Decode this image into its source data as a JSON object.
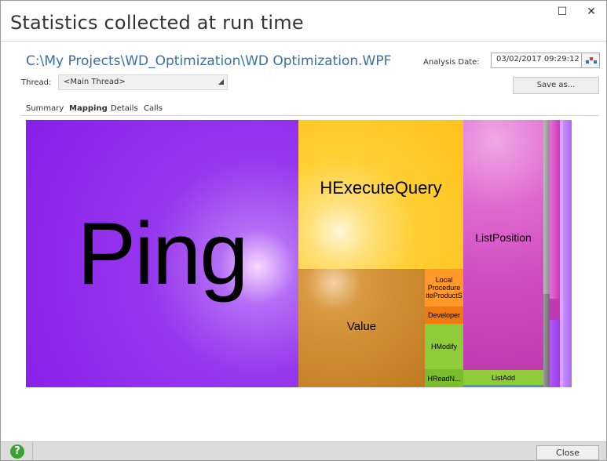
{
  "window": {
    "title": "Statistics collected at run time",
    "maximize_glyph": "☐",
    "close_glyph": "✕"
  },
  "header": {
    "file_path": "C:\\My Projects\\WD_Optimization\\WD Optimization.WPF",
    "analysis_date_label": "Analysis Date:",
    "analysis_date_value": "03/02/2017 09:29:12",
    "thread_label": "Thread:",
    "thread_value": "<Main Thread>",
    "save_as_label": "Save as..."
  },
  "tabs": [
    {
      "label": "Summary",
      "active": false
    },
    {
      "label": "Mapping",
      "active": true
    },
    {
      "label": "Details",
      "active": false
    },
    {
      "label": "Calls",
      "active": false
    }
  ],
  "treemap": {
    "cells": [
      {
        "label": "Ping",
        "color": "#9b3cf0"
      },
      {
        "label": "HExecuteQuery",
        "color": "#ffcf33"
      },
      {
        "label": "Value",
        "color": "#d08a2a"
      },
      {
        "label": "Local Procedure iteProductS",
        "color": "#ff9a2a"
      },
      {
        "label": "Developer",
        "color": "#f07a10"
      },
      {
        "label": "HModify",
        "color": "#8fcc3a"
      },
      {
        "label": "HReadN...",
        "color": "#7bbd30"
      },
      {
        "label": "ListPosition",
        "color": "#dc5ac8"
      },
      {
        "label": "ListAdd",
        "color": "#8fcc3a"
      }
    ]
  },
  "footer": {
    "help_glyph": "?",
    "close_label": "Close"
  },
  "colors": {
    "accent": "#3a6fa8",
    "help_green": "#3aa232"
  },
  "icons": {
    "calendar": "calendar-picker-icon",
    "help": "help-icon",
    "dropdown": "dropdown-arrow-icon"
  }
}
